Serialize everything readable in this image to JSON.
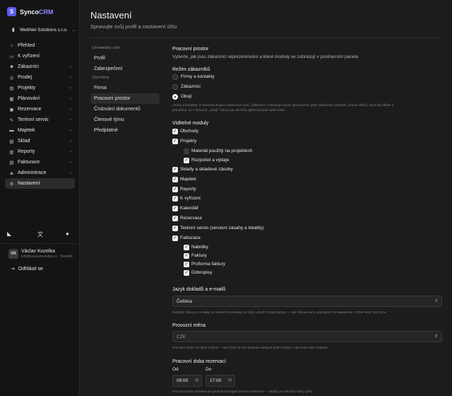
{
  "app": {
    "logo_letter": "S",
    "name_prefix": "Synco",
    "name_suffix": "CRM",
    "accent": "#5b5bf0"
  },
  "org": {
    "name": "WebNet Solutions s.r.o."
  },
  "sidebar": {
    "items": [
      {
        "label": "Přehled",
        "icon": "home-icon",
        "glyph": "⌂",
        "chevron": false
      },
      {
        "label": "K vyřízení",
        "icon": "inbox-icon",
        "glyph": "▭",
        "chevron": false
      },
      {
        "label": "Zákazníci",
        "icon": "users-icon",
        "glyph": "☻",
        "chevron": true
      },
      {
        "label": "Prodej",
        "icon": "coin-icon",
        "glyph": "◎",
        "chevron": true
      },
      {
        "label": "Projekty",
        "icon": "folder-icon",
        "glyph": "▤",
        "chevron": true
      },
      {
        "label": "Plánování",
        "icon": "calendar-icon",
        "glyph": "▦",
        "chevron": true
      },
      {
        "label": "Rezervace",
        "icon": "calendar-check-icon",
        "glyph": "▣",
        "chevron": true
      },
      {
        "label": "Terénní servis",
        "icon": "wrench-icon",
        "glyph": "✎",
        "chevron": true
      },
      {
        "label": "Majetek",
        "icon": "briefcase-icon",
        "glyph": "▬",
        "chevron": true
      },
      {
        "label": "Sklad",
        "icon": "box-icon",
        "glyph": "▧",
        "chevron": true
      },
      {
        "label": "Reporty",
        "icon": "chart-icon",
        "glyph": "▥",
        "chevron": true
      },
      {
        "label": "Fakturace",
        "icon": "receipt-icon",
        "glyph": "▤",
        "chevron": true
      },
      {
        "label": "Administrace",
        "icon": "shield-icon",
        "glyph": "◈",
        "chevron": true
      },
      {
        "label": "Nastavení",
        "icon": "gear-icon",
        "glyph": "⚙",
        "chevron": false,
        "active": true
      }
    ],
    "util_icons": [
      "brand-icon",
      "translate-icon",
      "bell-icon"
    ]
  },
  "user": {
    "initials": "VK",
    "name": "Václav Kozelka",
    "email": "info@vaclavkozelka.cz · Vlastník"
  },
  "logout": {
    "label": "Odhlásit se"
  },
  "header": {
    "title": "Nastavení",
    "subtitle": "Spravujte svůj profil a nastavení účtu"
  },
  "subnav": {
    "user_group": "Uživatelský účet",
    "user_items": [
      "Profil",
      "Zabezpečení"
    ],
    "company_group": "Účet firmy",
    "company_items": [
      "Firma",
      "Pracovní prostor",
      "Číslování dokumentů",
      "Členové týmu",
      "Předplatné"
    ],
    "active": "Pracovní prostor"
  },
  "workspace": {
    "title": "Pracovní prostor",
    "description": "Vyberte, jak jsou zákazníci reprezentováni a které moduly se zobrazují v postranním panelu",
    "mode": {
      "title": "Režim zákazníků",
      "options": [
        {
          "label": "Firmy a kontakty",
          "selected": false
        },
        {
          "label": "Zákazníci",
          "selected": false
        },
        {
          "label": "Obojí",
          "selected": true
        }
      ],
      "note_line1": "„Firmy a kontakty\" je klasická dvojice výběrových polí. „Zákazníci\" zobrazuje pouze sjednocený výběr zákazníka (nejlepší, pokud většinu obchodů děláte s",
      "note_line2": "jednotlivci, ne s firmami). „Obojí\" zobrazuje všechna výběrová pole vedle sebe."
    },
    "modules": {
      "title": "Viditelné moduly",
      "items": [
        {
          "label": "Obchody",
          "checked": true,
          "level": 0
        },
        {
          "label": "Projekty",
          "checked": true,
          "level": 0
        },
        {
          "label": "Materiál použitý na projektech",
          "checked": false,
          "level": 1
        },
        {
          "label": "Rozpočet a výdaje",
          "checked": true,
          "level": 1
        },
        {
          "label": "Sklady a skladové zásoby",
          "checked": true,
          "level": 0
        },
        {
          "label": "Majetek",
          "checked": true,
          "level": 0
        },
        {
          "label": "Reporty",
          "checked": true,
          "level": 0
        },
        {
          "label": "K vyřízení",
          "checked": true,
          "level": 0
        },
        {
          "label": "Kalendář",
          "checked": true,
          "level": 0
        },
        {
          "label": "Rezervace",
          "checked": true,
          "level": 0
        },
        {
          "label": "Terénní servis (servisní zásahy a lokality)",
          "checked": true,
          "level": 0
        },
        {
          "label": "Fakturace",
          "checked": true,
          "level": 0
        },
        {
          "label": "Nabídky",
          "checked": true,
          "level": 1
        },
        {
          "label": "Faktury",
          "checked": true,
          "level": 1
        },
        {
          "label": "Proforma faktury",
          "checked": true,
          "level": 1
        },
        {
          "label": "Dobropisy",
          "checked": true,
          "level": 1
        }
      ]
    },
    "language": {
      "title": "Jazyk dokladů a e-mailů",
      "value": "Čeština",
      "note": "Nabídky, faktury a e-maily, ve kterých se posílají, se vždy vytvoří v tomto jazyce — bez ohledu na to, jaký jazyk má nastavený v CRM daný člen týmu."
    },
    "currency": {
      "title": "Provozní měna",
      "value": "CZK",
      "note": "Provozní měnu už nelze změnit — tato firma už má uloženou alespoň jednu částku v obchodu nebo dokladu."
    },
    "hours": {
      "title": "Pracovní doba rezervací",
      "from_label": "Od",
      "to_label": "Do",
      "from_value": "09:00",
      "to_value": "17:00",
      "note": "Pracovní doba, ve které se generují dostupné termíny rezervací — stejná pro všechny členy týmu."
    }
  }
}
